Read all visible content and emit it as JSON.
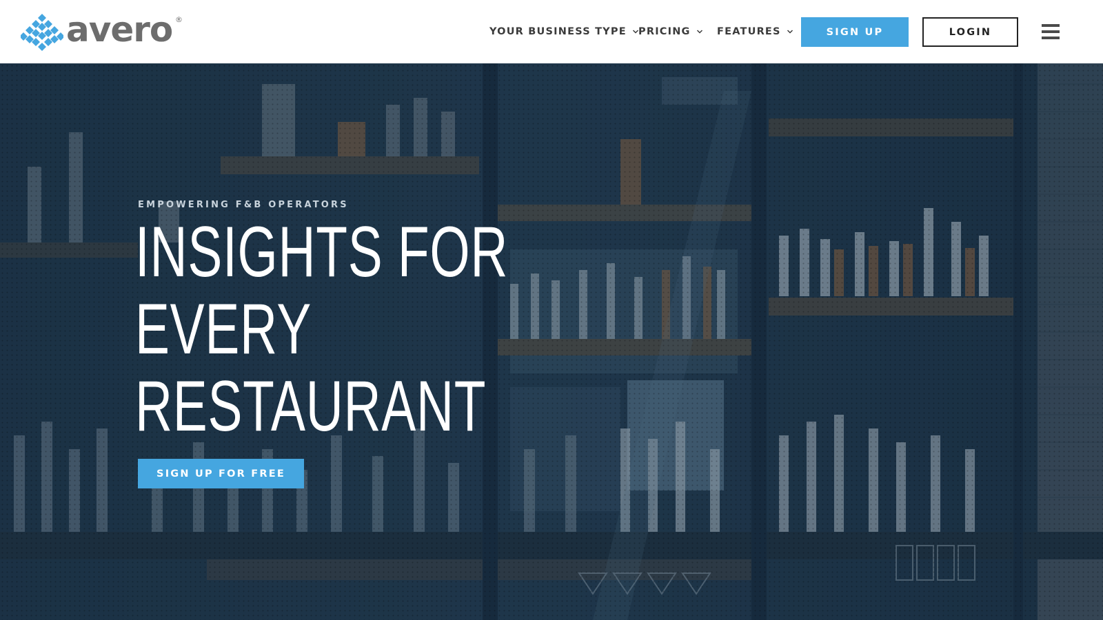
{
  "brand": {
    "name": "avero",
    "registered_mark": "®",
    "logo_icon": "avero-diamond-mark-icon",
    "logo_colors": [
      "#45a6e0",
      "#6d6d6d"
    ]
  },
  "nav": {
    "items": [
      {
        "label": "YOUR BUSINESS TYPE",
        "icon": "chevron-down-icon"
      },
      {
        "label": "PRICING",
        "icon": "chevron-down-icon"
      },
      {
        "label": "FEATURES",
        "icon": "chevron-down-icon"
      }
    ],
    "signup_label": "SIGN UP",
    "login_label": "LOGIN",
    "menu_icon": "hamburger-menu-icon"
  },
  "hero": {
    "background": "bar-shelves-with-liquor-bottles-photo",
    "eyebrow": "EMPOWERING F&B OPERATORS",
    "headline_lines": [
      "INSIGHTS FOR",
      "EVERY",
      "RESTAURANT"
    ],
    "cta_label": "SIGN UP FOR FREE"
  },
  "colors": {
    "accent": "#45a6e0",
    "hero_tint": "#1d3345",
    "nav_text": "#3b3b3b"
  }
}
